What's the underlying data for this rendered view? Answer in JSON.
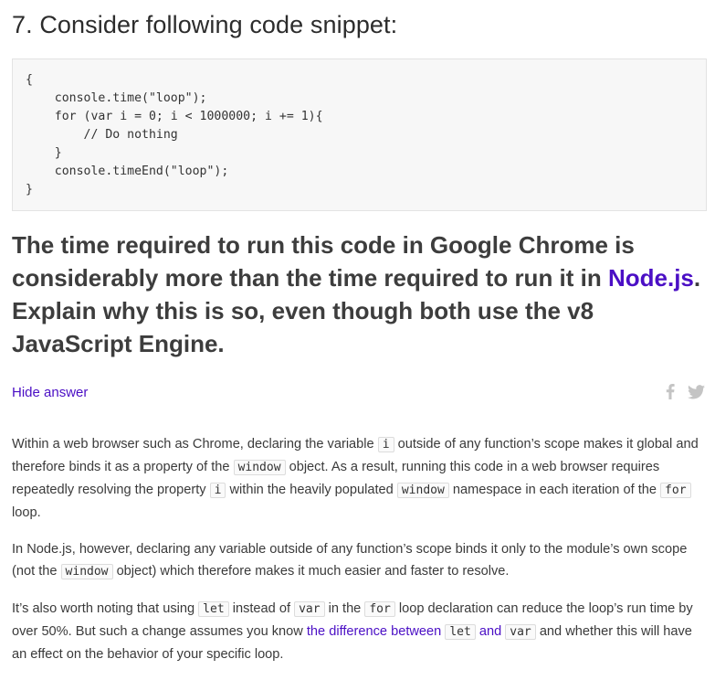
{
  "question": {
    "title": "7. Consider following code snippet:",
    "code_lines": [
      "{",
      "    console.time(\"loop\");",
      "    for (var i = 0; i < 1000000; i += 1){",
      "        // Do nothing",
      "    }",
      "    console.timeEnd(\"loop\");",
      "}"
    ],
    "statement_part1": "The time required to run this code in Google Chrome is considerably more than the time required to run it in ",
    "statement_link": "Node.js",
    "statement_part2": ". Explain why this is so, even though both use the v8 JavaScript Engine."
  },
  "toggle_label": "Hide answer",
  "share_icons": [
    "facebook-icon",
    "twitter-icon"
  ],
  "answer": {
    "p1": {
      "t1": "Within a web browser such as Chrome, declaring the variable ",
      "c1": "i",
      "t2": " outside of any function’s scope makes it global and therefore binds it as a property of the ",
      "c2": "window",
      "t3": " object. As a result, running this code in a web browser requires repeatedly resolving the property ",
      "c3": "i",
      "t4": " within the heavily populated ",
      "c4": "window",
      "t5": " namespace in each iteration of the ",
      "c5": "for",
      "t6": " loop."
    },
    "p2": {
      "t1": "In Node.js, however, declaring any variable outside of any function’s scope binds it only to the module’s own scope (not the ",
      "c1": "window",
      "t2": " object) which therefore makes it much easier and faster to resolve."
    },
    "p3": {
      "t1": "It’s also worth noting that using ",
      "c1": "let",
      "t2": " instead of ",
      "c2": "var",
      "t3": " in the ",
      "c3": "for",
      "t4": " loop declaration can reduce the loop’s run time by over 50%. But such a change assumes you know ",
      "link": "the difference between ",
      "c4": "let",
      "link_and": " and ",
      "c5": "var",
      "t5": " and whether this will have an effect on the behavior of your specific loop."
    }
  }
}
